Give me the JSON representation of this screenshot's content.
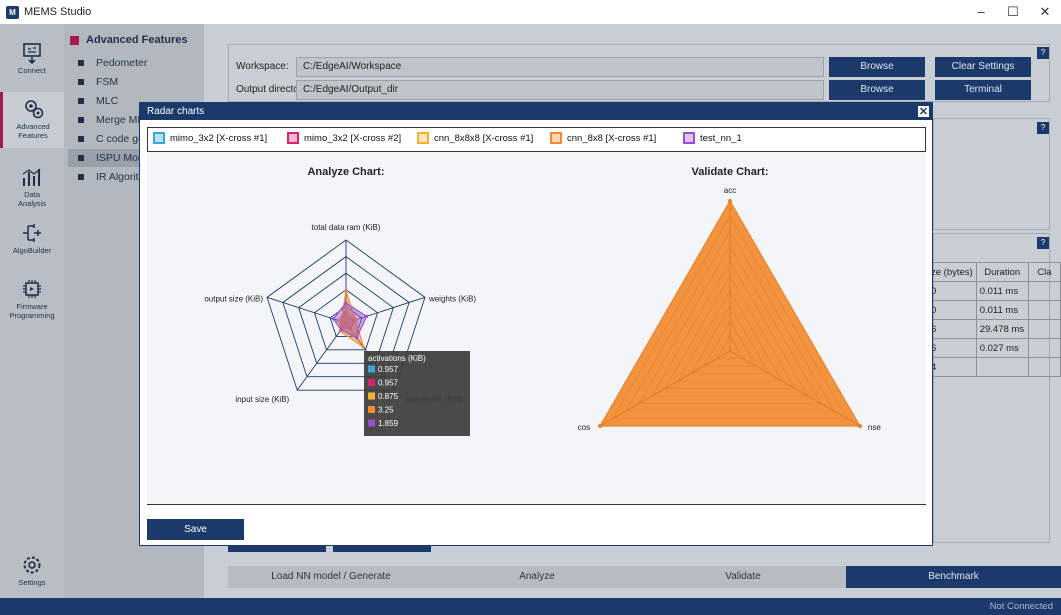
{
  "window": {
    "title": "MEMS Studio",
    "controls": [
      "–",
      "☐",
      "✕"
    ]
  },
  "rail": [
    {
      "label": "Connect",
      "icon": "connect-icon"
    },
    {
      "label": "Advanced Features",
      "icon": "advanced-features-icon",
      "active": true
    },
    {
      "label": "Data Analysis",
      "icon": "data-analysis-icon"
    },
    {
      "label": "AlgoBuilder",
      "icon": "algobuilder-icon"
    },
    {
      "label": "Firmware Programming",
      "icon": "firmware-programming-icon"
    },
    {
      "label": "Settings",
      "icon": "settings-icon"
    }
  ],
  "menu": {
    "header": "Advanced Features",
    "items": [
      "Pedometer",
      "FSM",
      "MLC",
      "Merge MLC",
      "C code gene",
      "ISPU Model",
      "IR Algorithm"
    ],
    "selected": "ISPU Model"
  },
  "main": {
    "workspace_label": "Workspace:",
    "workspace_value": "C:/EdgeAI/Workspace",
    "output_label": "Output directory:",
    "output_value": "C:/EdgeAI/Output_dir",
    "browse_label": "Browse",
    "clear_settings_label": "Clear Settings",
    "terminal_label": "Terminal",
    "help_label": "?",
    "table_headers": [
      "ze (bytes)",
      "Duration",
      "Cla"
    ],
    "table_rows": [
      [
        "0",
        "0.011 ms",
        ""
      ],
      [
        "0",
        "0.011 ms",
        ""
      ],
      [
        "6",
        "29.478 ms",
        ""
      ],
      [
        "6",
        "0.027 ms",
        ""
      ],
      [
        "4",
        "",
        ""
      ]
    ],
    "tabs": [
      "Load NN model / Generate",
      "Analyze",
      "Validate",
      "Benchmark"
    ]
  },
  "status": {
    "connection": "Not Connected"
  },
  "modal": {
    "title": "Radar charts",
    "save_label": "Save",
    "legend": [
      {
        "name": "mimo_3x2 [X-cross #1]",
        "color": "#3aa6d8"
      },
      {
        "name": "mimo_3x2 [X-cross #2]",
        "color": "#d6246f"
      },
      {
        "name": "cnn_8x8x8 [X-cross #1]",
        "color": "#f2b134"
      },
      {
        "name": "cnn_8x8 [X-cross #1]",
        "color": "#f28a2e"
      },
      {
        "name": "test_nn_1",
        "color": "#9b4fd0"
      }
    ],
    "tooltip": {
      "title": "activations (KiB)",
      "values": [
        "0.957",
        "0.957",
        "0.875",
        "3.25",
        "1.859"
      ]
    }
  },
  "chart_data": [
    {
      "type": "radar",
      "title": "Analyze Chart:",
      "axes": [
        "total data ram (KiB)",
        "weights (KiB)",
        "activations (KiB)",
        "input size (KiB)",
        "output size (KiB)"
      ],
      "rings": 5,
      "series": [
        {
          "name": "mimo_3x2 [X-cross #1]",
          "values": [
            0.1,
            0.12,
            0.09,
            0.06,
            0.08
          ]
        },
        {
          "name": "mimo_3x2 [X-cross #2]",
          "values": [
            0.12,
            0.1,
            0.09,
            0.07,
            0.1
          ]
        },
        {
          "name": "cnn_8x8x8 [X-cross #1]",
          "values": [
            0.18,
            0.14,
            0.2,
            0.1,
            0.09
          ]
        },
        {
          "name": "cnn_8x8 [X-cross #1]",
          "values": [
            0.38,
            0.12,
            0.36,
            0.12,
            0.06
          ]
        },
        {
          "name": "test_nn_1",
          "values": [
            0.24,
            0.26,
            0.22,
            0.1,
            0.16
          ]
        }
      ]
    },
    {
      "type": "radar",
      "title": "Validate Chart:",
      "axes": [
        "acc",
        "nse",
        "cos"
      ],
      "rings": 10,
      "series": [
        {
          "name": "cnn_8x8 [X-cross #1]",
          "values": [
            1.0,
            1.0,
            1.0
          ]
        }
      ]
    }
  ]
}
